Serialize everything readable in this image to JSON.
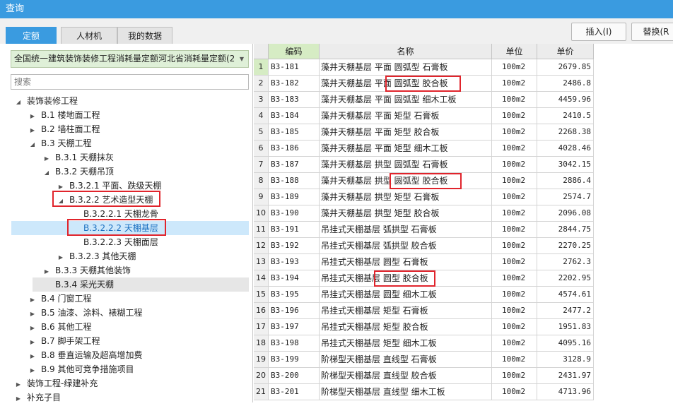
{
  "window": {
    "title": "查询"
  },
  "tabs": [
    {
      "label": "定额",
      "active": true
    },
    {
      "label": "人材机",
      "active": false
    },
    {
      "label": "我的数据",
      "active": false
    }
  ],
  "toolbar": {
    "insert_label": "插入(I)",
    "replace_label": "替换(R"
  },
  "left_panel": {
    "library_select": "全国统一建筑装饰装修工程消耗量定额河北省消耗量定额(20",
    "search_placeholder": "搜索",
    "tree": [
      {
        "label": "装饰装修工程",
        "level": 0,
        "toggle": "open"
      },
      {
        "label": "B.1 楼地面工程",
        "level": 1,
        "toggle": "closed"
      },
      {
        "label": "B.2 墙柱面工程",
        "level": 1,
        "toggle": "closed"
      },
      {
        "label": "B.3 天棚工程",
        "level": 1,
        "toggle": "open"
      },
      {
        "label": "B.3.1 天棚抹灰",
        "level": 2,
        "toggle": "closed"
      },
      {
        "label": "B.3.2 天棚吊顶",
        "level": 2,
        "toggle": "open"
      },
      {
        "label": "B.3.2.1 平面、跌级天棚",
        "level": 3,
        "toggle": "closed"
      },
      {
        "label": "B.3.2.2 艺术造型天棚",
        "level": 3,
        "toggle": "open",
        "boxed": true
      },
      {
        "label": "B.3.2.2.1 天棚龙骨",
        "level": 4,
        "toggle": "none"
      },
      {
        "label": "B.3.2.2.2 天棚基层",
        "level": 4,
        "toggle": "none",
        "selected": true,
        "boxed": true
      },
      {
        "label": "B.3.2.2.3 天棚面层",
        "level": 4,
        "toggle": "none"
      },
      {
        "label": "B.3.2.3 其他天棚",
        "level": 3,
        "toggle": "closed"
      },
      {
        "label": "B.3.3 天棚其他装饰",
        "level": 2,
        "toggle": "closed"
      },
      {
        "label": "B.3.4 采光天棚",
        "level": 2,
        "toggle": "none",
        "grey": true
      },
      {
        "label": "B.4 门窗工程",
        "level": 1,
        "toggle": "closed"
      },
      {
        "label": "B.5 油漆、涂料、裱糊工程",
        "level": 1,
        "toggle": "closed"
      },
      {
        "label": "B.6 其他工程",
        "level": 1,
        "toggle": "closed"
      },
      {
        "label": "B.7 脚手架工程",
        "level": 1,
        "toggle": "closed"
      },
      {
        "label": "B.8 垂直运输及超高增加费",
        "level": 1,
        "toggle": "closed"
      },
      {
        "label": "B.9 其他可竞争措施项目",
        "level": 1,
        "toggle": "closed"
      },
      {
        "label": "装饰工程-绿建补充",
        "level": 0,
        "toggle": "closed"
      },
      {
        "label": "补充子目",
        "level": 0,
        "toggle": "closed"
      }
    ]
  },
  "table": {
    "headers": {
      "code": "编码",
      "name": "名称",
      "unit": "单位",
      "price": "单价"
    },
    "rows": [
      {
        "idx": "1",
        "code": "B3-181",
        "name": "藻井天棚基层 平面 圆弧型 石膏板",
        "unit": "100m2",
        "price": "2679.85"
      },
      {
        "idx": "2",
        "code": "B3-182",
        "name": "藻井天棚基层 平面 圆弧型 胶合板",
        "unit": "100m2",
        "price": "2486.8"
      },
      {
        "idx": "3",
        "code": "B3-183",
        "name": "藻井天棚基层 平面 圆弧型 细木工板",
        "unit": "100m2",
        "price": "4459.96"
      },
      {
        "idx": "4",
        "code": "B3-184",
        "name": "藻井天棚基层 平面 矩型 石膏板",
        "unit": "100m2",
        "price": "2410.5"
      },
      {
        "idx": "5",
        "code": "B3-185",
        "name": "藻井天棚基层 平面 矩型 胶合板",
        "unit": "100m2",
        "price": "2268.38"
      },
      {
        "idx": "6",
        "code": "B3-186",
        "name": "藻井天棚基层 平面 矩型 细木工板",
        "unit": "100m2",
        "price": "4028.46"
      },
      {
        "idx": "7",
        "code": "B3-187",
        "name": "藻井天棚基层 拱型 圆弧型 石膏板",
        "unit": "100m2",
        "price": "3042.15"
      },
      {
        "idx": "8",
        "code": "B3-188",
        "name": "藻井天棚基层 拱型 圆弧型 胶合板",
        "unit": "100m2",
        "price": "2886.4"
      },
      {
        "idx": "9",
        "code": "B3-189",
        "name": "藻井天棚基层 拱型 矩型 石膏板",
        "unit": "100m2",
        "price": "2574.7"
      },
      {
        "idx": "10",
        "code": "B3-190",
        "name": "藻井天棚基层 拱型 矩型 胶合板",
        "unit": "100m2",
        "price": "2096.08"
      },
      {
        "idx": "11",
        "code": "B3-191",
        "name": "吊挂式天棚基层 弧拱型 石膏板",
        "unit": "100m2",
        "price": "2844.75"
      },
      {
        "idx": "12",
        "code": "B3-192",
        "name": "吊挂式天棚基层 弧拱型 胶合板",
        "unit": "100m2",
        "price": "2270.25"
      },
      {
        "idx": "13",
        "code": "B3-193",
        "name": "吊挂式天棚基层 圆型 石膏板",
        "unit": "100m2",
        "price": "2762.3"
      },
      {
        "idx": "14",
        "code": "B3-194",
        "name": "吊挂式天棚基层 圆型 胶合板",
        "unit": "100m2",
        "price": "2202.95"
      },
      {
        "idx": "15",
        "code": "B3-195",
        "name": "吊挂式天棚基层 圆型 细木工板",
        "unit": "100m2",
        "price": "4574.61"
      },
      {
        "idx": "16",
        "code": "B3-196",
        "name": "吊挂式天棚基层 矩型 石膏板",
        "unit": "100m2",
        "price": "2477.2"
      },
      {
        "idx": "17",
        "code": "B3-197",
        "name": "吊挂式天棚基层 矩型 胶合板",
        "unit": "100m2",
        "price": "1951.83"
      },
      {
        "idx": "18",
        "code": "B3-198",
        "name": "吊挂式天棚基层 矩型 细木工板",
        "unit": "100m2",
        "price": "4095.16"
      },
      {
        "idx": "19",
        "code": "B3-199",
        "name": "阶梯型天棚基层 直线型 石膏板",
        "unit": "100m2",
        "price": "3128.9"
      },
      {
        "idx": "20",
        "code": "B3-200",
        "name": "阶梯型天棚基层 直线型 胶合板",
        "unit": "100m2",
        "price": "2431.97"
      },
      {
        "idx": "21",
        "code": "B3-201",
        "name": "阶梯型天棚基层 直线型 细木工板",
        "unit": "100m2",
        "price": "4713.96"
      }
    ]
  },
  "colors": {
    "accent": "#3a9be0",
    "highlight_box": "#e0242c",
    "selected_row": "#cde8fb",
    "select_bg": "#dff0d8"
  }
}
